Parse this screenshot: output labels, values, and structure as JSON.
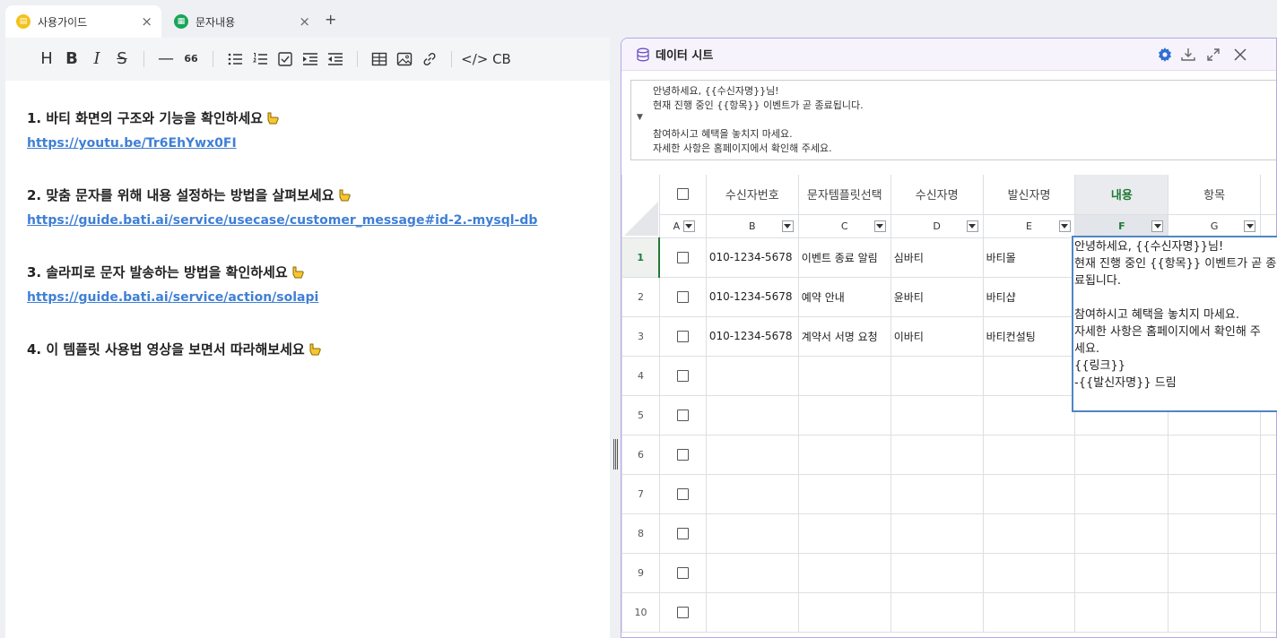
{
  "tabs": [
    {
      "label": "사용가이드",
      "icon": "guide-tab-icon",
      "active": true
    },
    {
      "label": "문자내용",
      "icon": "sheet-tab-icon",
      "active": false
    }
  ],
  "tab_add_label": "+",
  "tab_close_label": "×",
  "toolbar": {
    "heading": "H",
    "bold": "B",
    "italic": "I",
    "strike": "S",
    "hr": "—",
    "quote": "66",
    "codeblock": "</> CB"
  },
  "guide": {
    "items": [
      {
        "title": "1. 바티 화면의 구조와 기능을 확인하세요",
        "link": "https://youtu.be/Tr6EhYwx0FI"
      },
      {
        "title": "2. 맞춤 문자를 위해 내용 설정하는 방법을 살펴보세요",
        "link": "https://guide.bati.ai/service/usecase/customer_message#id-2.-mysql-db"
      },
      {
        "title": "3. 솔라피로 문자 발송하는 방법을 확인하세요",
        "link": "https://guide.bati.ai/service/action/solapi"
      },
      {
        "title": "4. 이 템플릿 사용법 영상을 보면서 따라해보세요",
        "link": ""
      }
    ]
  },
  "sheet": {
    "title": "데이터 시트",
    "message_preview": "안녕하세요, {{수신자명}}님!\n현재 진행 중인 {{항목}} 이벤트가 곧 종료됩니다.\n\n참여하시고 혜택을 놓치지 마세요.\n자세한 사항은 홈페이지에서 확인해 주세요.",
    "columns": [
      {
        "letter": "A",
        "header": ""
      },
      {
        "letter": "B",
        "header": "수신자번호"
      },
      {
        "letter": "C",
        "header": "문자템플릿선택"
      },
      {
        "letter": "D",
        "header": "수신자명"
      },
      {
        "letter": "E",
        "header": "발신자명"
      },
      {
        "letter": "F",
        "header": "내용"
      },
      {
        "letter": "G",
        "header": "항목"
      }
    ],
    "rows": [
      {
        "num": "1",
        "phone": "010-1234-5678",
        "template": "이벤트 종료 알림",
        "recipient": "심바티",
        "sender": "바티몰"
      },
      {
        "num": "2",
        "phone": "010-1234-5678",
        "template": "예약 안내",
        "recipient": "윤바티",
        "sender": "바티샵"
      },
      {
        "num": "3",
        "phone": "010-1234-5678",
        "template": "계약서 서명 요청",
        "recipient": "이바티",
        "sender": "바티컨설팅"
      },
      {
        "num": "4",
        "phone": "",
        "template": "",
        "recipient": "",
        "sender": ""
      },
      {
        "num": "5",
        "phone": "",
        "template": "",
        "recipient": "",
        "sender": ""
      },
      {
        "num": "6",
        "phone": "",
        "template": "",
        "recipient": "",
        "sender": ""
      },
      {
        "num": "7",
        "phone": "",
        "template": "",
        "recipient": "",
        "sender": ""
      },
      {
        "num": "8",
        "phone": "",
        "template": "",
        "recipient": "",
        "sender": ""
      },
      {
        "num": "9",
        "phone": "",
        "template": "",
        "recipient": "",
        "sender": ""
      },
      {
        "num": "10",
        "phone": "",
        "template": "",
        "recipient": "",
        "sender": ""
      }
    ],
    "cell_editor_text": "안녕하세요, {{수신자명}}님!\n현재 진행 중인 {{항목}} 이벤트가 곧 종\n료됩니다.\n\n참여하시고 혜택을 놓치지 마세요.\n자세한 사항은 홈페이지에서 확인해 주\n세요.\n{{링크}}\n-{{발신자명}} 드림"
  },
  "colors": {
    "accent_purple": "#b9a7e6",
    "selected_green": "#1f7a36",
    "link_blue": "#3f7fd6",
    "settings_blue": "#2f6fd0"
  }
}
